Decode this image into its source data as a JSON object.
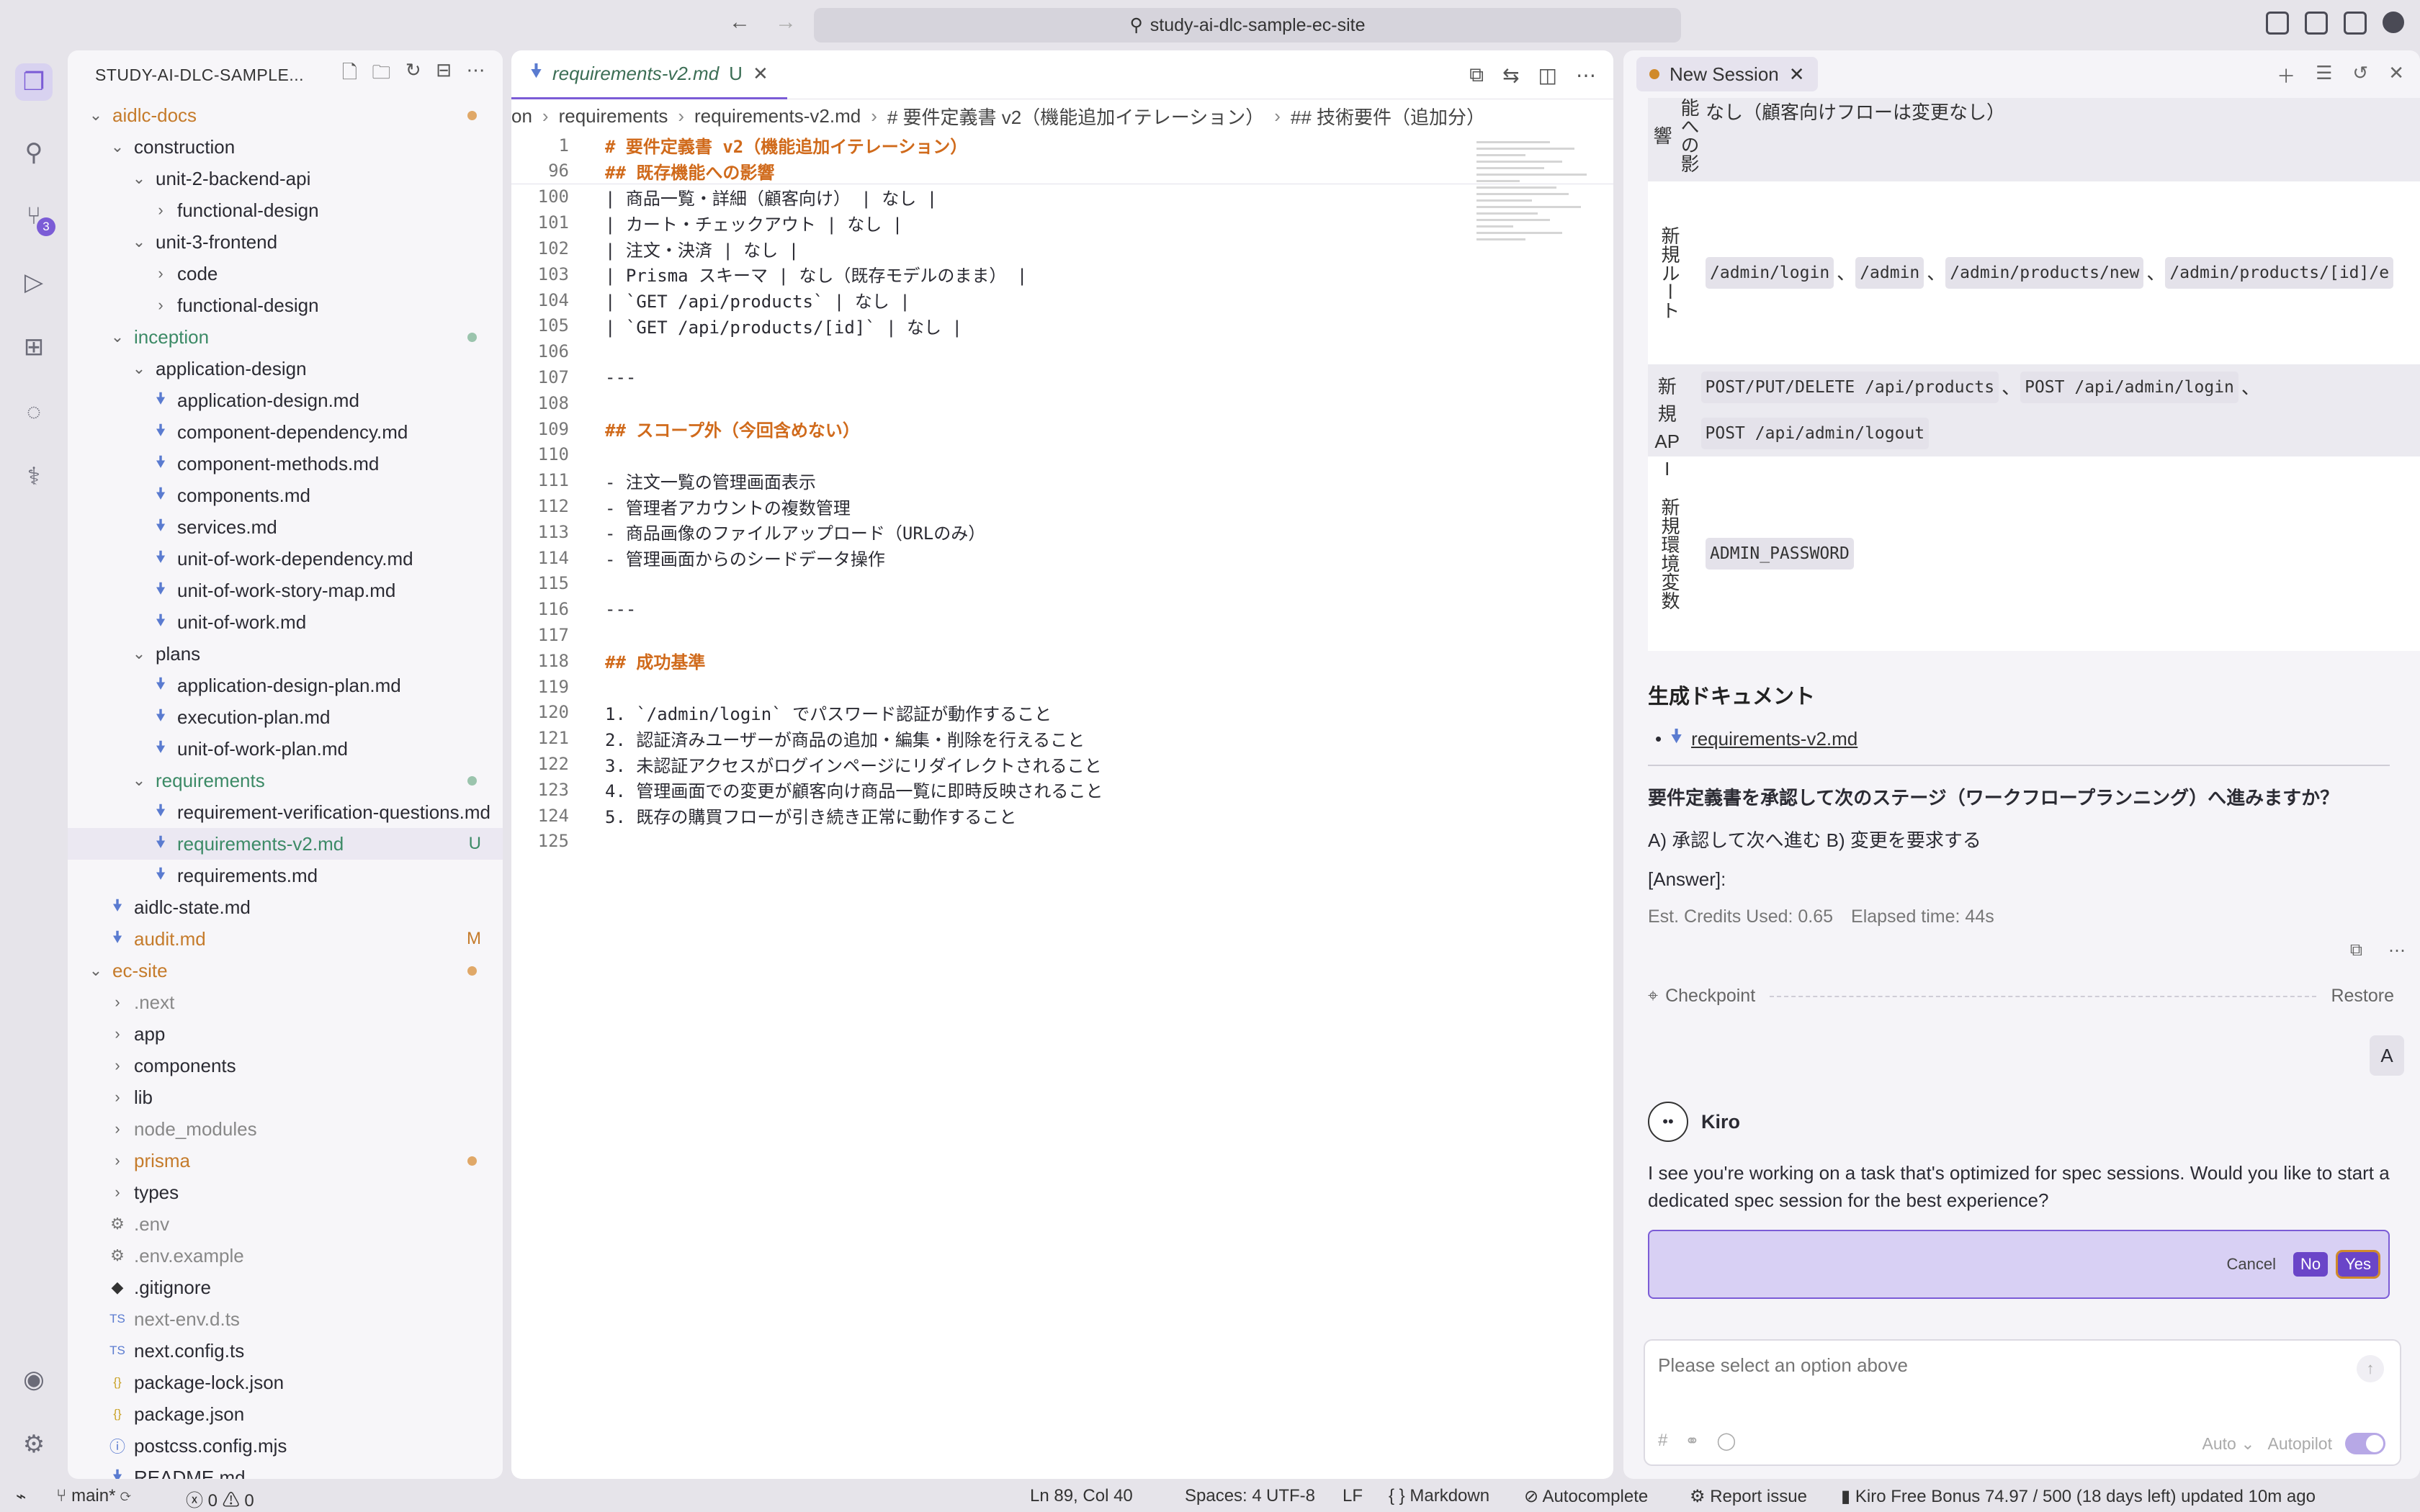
{
  "titlebar": {
    "search_text": "study-ai-dlc-sample-ec-site"
  },
  "activity": {
    "scm_badge": "3"
  },
  "explorer": {
    "title": "STUDY-AI-DLC-SAMPLE...",
    "tree": [
      {
        "label": "aidlc-docs",
        "indent": 0,
        "type": "folder",
        "open": true,
        "color": "#c57b2b",
        "dot": "#e0a868"
      },
      {
        "label": "construction",
        "indent": 1,
        "type": "folder",
        "open": true
      },
      {
        "label": "unit-2-backend-api",
        "indent": 2,
        "type": "folder",
        "open": true
      },
      {
        "label": "functional-design",
        "indent": 3,
        "type": "folder",
        "open": false
      },
      {
        "label": "unit-3-frontend",
        "indent": 2,
        "type": "folder",
        "open": true
      },
      {
        "label": "code",
        "indent": 3,
        "type": "folder",
        "open": false
      },
      {
        "label": "functional-design",
        "indent": 3,
        "type": "folder",
        "open": false
      },
      {
        "label": "inception",
        "indent": 1,
        "type": "folder",
        "open": true,
        "color": "#3c8a66",
        "dot": "#9bc4ad"
      },
      {
        "label": "application-design",
        "indent": 2,
        "type": "folder",
        "open": true
      },
      {
        "label": "application-design.md",
        "indent": 3,
        "type": "md"
      },
      {
        "label": "component-dependency.md",
        "indent": 3,
        "type": "md"
      },
      {
        "label": "component-methods.md",
        "indent": 3,
        "type": "md"
      },
      {
        "label": "components.md",
        "indent": 3,
        "type": "md"
      },
      {
        "label": "services.md",
        "indent": 3,
        "type": "md"
      },
      {
        "label": "unit-of-work-dependency.md",
        "indent": 3,
        "type": "md"
      },
      {
        "label": "unit-of-work-story-map.md",
        "indent": 3,
        "type": "md"
      },
      {
        "label": "unit-of-work.md",
        "indent": 3,
        "type": "md"
      },
      {
        "label": "plans",
        "indent": 2,
        "type": "folder",
        "open": true
      },
      {
        "label": "application-design-plan.md",
        "indent": 3,
        "type": "md"
      },
      {
        "label": "execution-plan.md",
        "indent": 3,
        "type": "md"
      },
      {
        "label": "unit-of-work-plan.md",
        "indent": 3,
        "type": "md"
      },
      {
        "label": "requirements",
        "indent": 2,
        "type": "folder",
        "open": true,
        "color": "#3c8a66",
        "dot": "#9bc4ad"
      },
      {
        "label": "requirement-verification-questions.md",
        "indent": 3,
        "type": "md"
      },
      {
        "label": "requirements-v2.md",
        "indent": 3,
        "type": "md",
        "color": "#3c8a66",
        "status": "U",
        "status_color": "#3c8a66",
        "selected": true
      },
      {
        "label": "requirements.md",
        "indent": 3,
        "type": "md"
      },
      {
        "label": "aidlc-state.md",
        "indent": 1,
        "type": "md"
      },
      {
        "label": "audit.md",
        "indent": 1,
        "type": "md",
        "color": "#c57b2b",
        "status": "M",
        "status_color": "#c57b2b"
      },
      {
        "label": "ec-site",
        "indent": 0,
        "type": "folder",
        "open": true,
        "color": "#c57b2b",
        "dot": "#e0a868"
      },
      {
        "label": ".next",
        "indent": 1,
        "type": "folder",
        "open": false,
        "color": "#888"
      },
      {
        "label": "app",
        "indent": 1,
        "type": "folder",
        "open": false
      },
      {
        "label": "components",
        "indent": 1,
        "type": "folder",
        "open": false
      },
      {
        "label": "lib",
        "indent": 1,
        "type": "folder",
        "open": false
      },
      {
        "label": "node_modules",
        "indent": 1,
        "type": "folder",
        "open": false,
        "color": "#888"
      },
      {
        "label": "prisma",
        "indent": 1,
        "type": "folder",
        "open": false,
        "color": "#c57b2b",
        "dot": "#e0a868"
      },
      {
        "label": "types",
        "indent": 1,
        "type": "folder",
        "open": false
      },
      {
        "label": ".env",
        "indent": 1,
        "type": "gear",
        "color": "#888"
      },
      {
        "label": ".env.example",
        "indent": 1,
        "type": "gear",
        "color": "#888"
      },
      {
        "label": ".gitignore",
        "indent": 1,
        "type": "git"
      },
      {
        "label": "next-env.d.ts",
        "indent": 1,
        "type": "ts",
        "color": "#888"
      },
      {
        "label": "next.config.ts",
        "indent": 1,
        "type": "ts"
      },
      {
        "label": "package-lock.json",
        "indent": 1,
        "type": "json"
      },
      {
        "label": "package.json",
        "indent": 1,
        "type": "json"
      },
      {
        "label": "postcss.config.mjs",
        "indent": 1,
        "type": "js"
      },
      {
        "label": "README.md",
        "indent": 1,
        "type": "md"
      }
    ]
  },
  "editor": {
    "tab_label": "requirements-v2.md",
    "tab_status": "U",
    "breadcrumb": [
      "on",
      "requirements",
      "requirements-v2.md",
      "# 要件定義書 v2（機能追加イテレーション）",
      "## 技術要件（追加分）"
    ],
    "sticky": [
      {
        "n": "1",
        "text": "# 要件定義書 v2（機能追加イテレーション）",
        "heading": true
      },
      {
        "n": "96",
        "text": "## 既存機能への影響",
        "heading": true
      }
    ],
    "lines": [
      {
        "n": "100",
        "text": "| 商品一覧・詳細（顧客向け） | なし |"
      },
      {
        "n": "101",
        "text": "| カート・チェックアウト | なし |"
      },
      {
        "n": "102",
        "text": "| 注文・決済 | なし |"
      },
      {
        "n": "103",
        "text": "| Prisma スキーマ | なし（既存モデルのまま） |"
      },
      {
        "n": "104",
        "text": "| `GET /api/products` | なし |"
      },
      {
        "n": "105",
        "text": "| `GET /api/products/[id]` | なし |"
      },
      {
        "n": "106",
        "text": ""
      },
      {
        "n": "107",
        "text": "---"
      },
      {
        "n": "108",
        "text": ""
      },
      {
        "n": "109",
        "text": "## スコープ外（今回含めない）",
        "heading": true
      },
      {
        "n": "110",
        "text": ""
      },
      {
        "n": "111",
        "text": "- 注文一覧の管理画面表示"
      },
      {
        "n": "112",
        "text": "- 管理者アカウントの複数管理"
      },
      {
        "n": "113",
        "text": "- 商品画像のファイルアップロード（URLのみ）"
      },
      {
        "n": "114",
        "text": "- 管理画面からのシードデータ操作"
      },
      {
        "n": "115",
        "text": ""
      },
      {
        "n": "116",
        "text": "---"
      },
      {
        "n": "117",
        "text": ""
      },
      {
        "n": "118",
        "text": "## 成功基準",
        "heading": true
      },
      {
        "n": "119",
        "text": ""
      },
      {
        "n": "120",
        "text": "1. `/admin/login` でパスワード認証が動作すること"
      },
      {
        "n": "121",
        "text": "2. 認証済みユーザーが商品の追加・編集・削除を行えること"
      },
      {
        "n": "122",
        "text": "3. 未認証アクセスがログインページにリダイレクトされること"
      },
      {
        "n": "123",
        "text": "4. 管理画面での変更が顧客向け商品一覧に即時反映されること"
      },
      {
        "n": "124",
        "text": "5. 既存の購買フローが引き続き正常に動作すること"
      },
      {
        "n": "125",
        "text": ""
      }
    ]
  },
  "chat": {
    "tab_label": "New Session",
    "table": {
      "row1_key": "能への影響",
      "row1_val": "なし（顧客向けフローは変更なし）",
      "row2_key": "新規ルート",
      "row2_chips": [
        "/admin/login",
        "/admin",
        "/admin/products/new",
        "/admin/products/[id]/e"
      ],
      "row3_key": "新規API",
      "row3_chips": [
        "POST/PUT/DELETE /api/products",
        "POST /api/admin/login",
        "POST /api/admin/logout"
      ],
      "row4_key": "新規環境変数",
      "row4_chips": [
        "ADMIN_PASSWORD"
      ]
    },
    "gen_heading": "生成ドキュメント",
    "gen_link": "requirements-v2.md",
    "question": "要件定義書を承認して次のステージ（ワークフロープランニング）へ進みますか？",
    "options": "A) 承認して次へ進む B) 変更を要求する",
    "answer": "[Answer]:",
    "credits": "Est. Credits Used: 0.65",
    "elapsed": "Elapsed time: 44s",
    "checkpoint": "Checkpoint",
    "restore": "Restore",
    "user_avatar": "A",
    "kiro_name": "Kiro",
    "kiro_msg": "I see you're working on a task that's optimized for spec sessions. Would you like to start a dedicated spec session for the best experience?",
    "cancel": "Cancel",
    "no": "No",
    "yes": "Yes",
    "input_placeholder": "Please select an option above",
    "model": "Auto",
    "autopilot": "Autopilot"
  },
  "statusbar": {
    "branch": "main*",
    "errors": "0",
    "warnings": "0",
    "position": "Ln 89, Col 40",
    "spaces": "Spaces: 4",
    "encoding": "UTF-8",
    "eol": "LF",
    "language": "Markdown",
    "autocomplete": "Autocomplete",
    "report": "Report issue",
    "bonus": "Kiro Free Bonus 74.97 / 500 (18 days left) updated 10m ago"
  }
}
